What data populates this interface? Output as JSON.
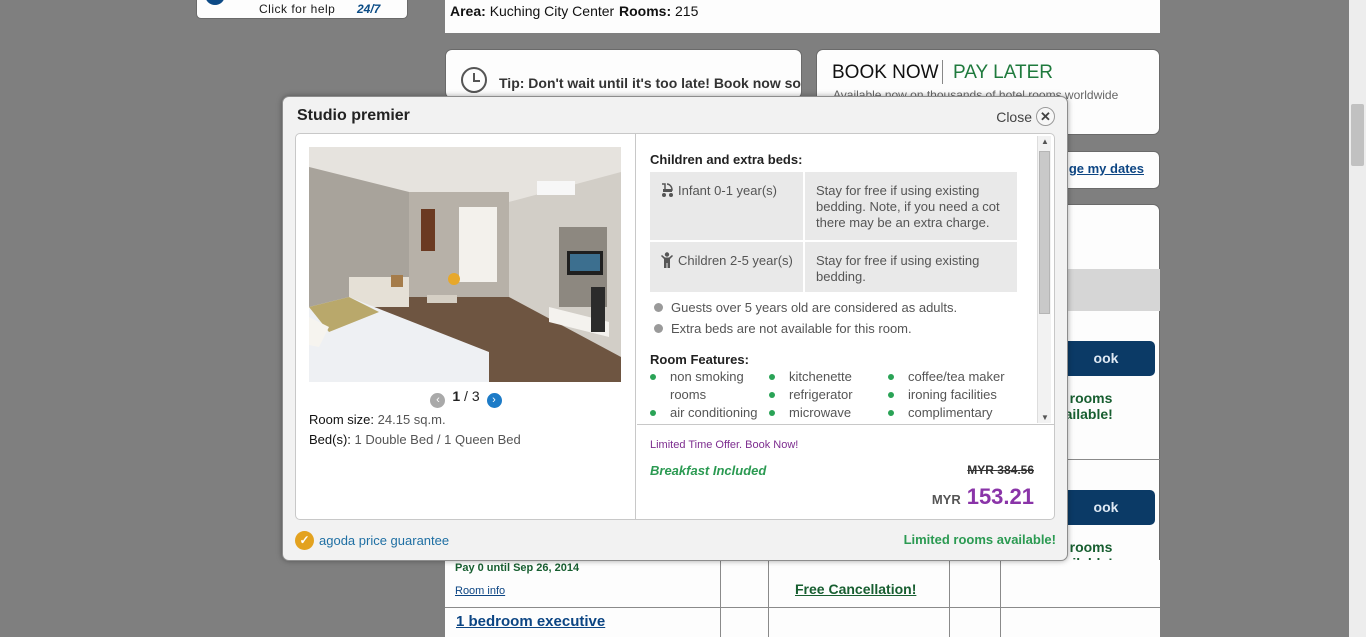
{
  "background": {
    "help": {
      "label": "Click for help",
      "badge": "24/7"
    },
    "hotel": {
      "area_label": "Area:",
      "area_value": "Kuching City Center",
      "rooms_label": "Rooms:",
      "rooms_value": "215"
    },
    "tip": {
      "text": "Tip: Don't wait until it's too late! Book now so"
    },
    "promo": {
      "book_now": "BOOK NOW",
      "pay_later": "PAY LATER",
      "subtitle": "Available now on thousands of hotel rooms worldwide"
    },
    "change_dates_label": "ge my dates",
    "book_buttons": [
      "ook",
      "ook"
    ],
    "limited_rooms": [
      "ed rooms\navailable!",
      "ed rooms\navailable!"
    ],
    "pay_note": "Pay 0 until Sep 26, 2014",
    "room_info_link": "Room info",
    "free_cancellation": "Free Cancellation!",
    "next_room": "1 bedroom executive"
  },
  "modal": {
    "title": "Studio premier",
    "close_label": "Close",
    "gallery": {
      "current": "1",
      "total": "3",
      "separator": "/"
    },
    "room_size_label": "Room size:",
    "room_size_value": "24.15 sq.m.",
    "beds_label": "Bed(s):",
    "beds_value": "1 Double Bed / 1 Queen Bed",
    "children_title": "Children and extra beds:",
    "children_policies": [
      {
        "icon": "stroller-icon",
        "age": "Infant 0-1 year(s)",
        "policy": "Stay for free if using existing bedding. Note, if you need a cot there may be an extra charge."
      },
      {
        "icon": "child-icon",
        "age": "Children 2-5 year(s)",
        "policy": "Stay for free if using existing bedding."
      }
    ],
    "notes": [
      "Guests over 5 years old are considered as adults.",
      "Extra beds are not available for this room."
    ],
    "features_title": "Room Features:",
    "features": [
      [
        "non smoking rooms",
        "air conditioning"
      ],
      [
        "kitchenette",
        "refrigerator",
        "microwave"
      ],
      [
        "coffee/tea maker",
        "ironing facilities",
        "complimentary"
      ]
    ],
    "offer": "Limited Time Offer. Book Now!",
    "breakfast": "Breakfast Included",
    "old_price": {
      "currency": "MYR",
      "amount": "384.56"
    },
    "new_price": {
      "currency": "MYR",
      "amount": "153.21"
    },
    "guarantee": "agoda price guarantee",
    "limited": "Limited rooms available!"
  },
  "colors": {
    "accent_green": "#2b9a52",
    "price_purple": "#8a34a8",
    "link_blue": "#1f6fa3"
  }
}
